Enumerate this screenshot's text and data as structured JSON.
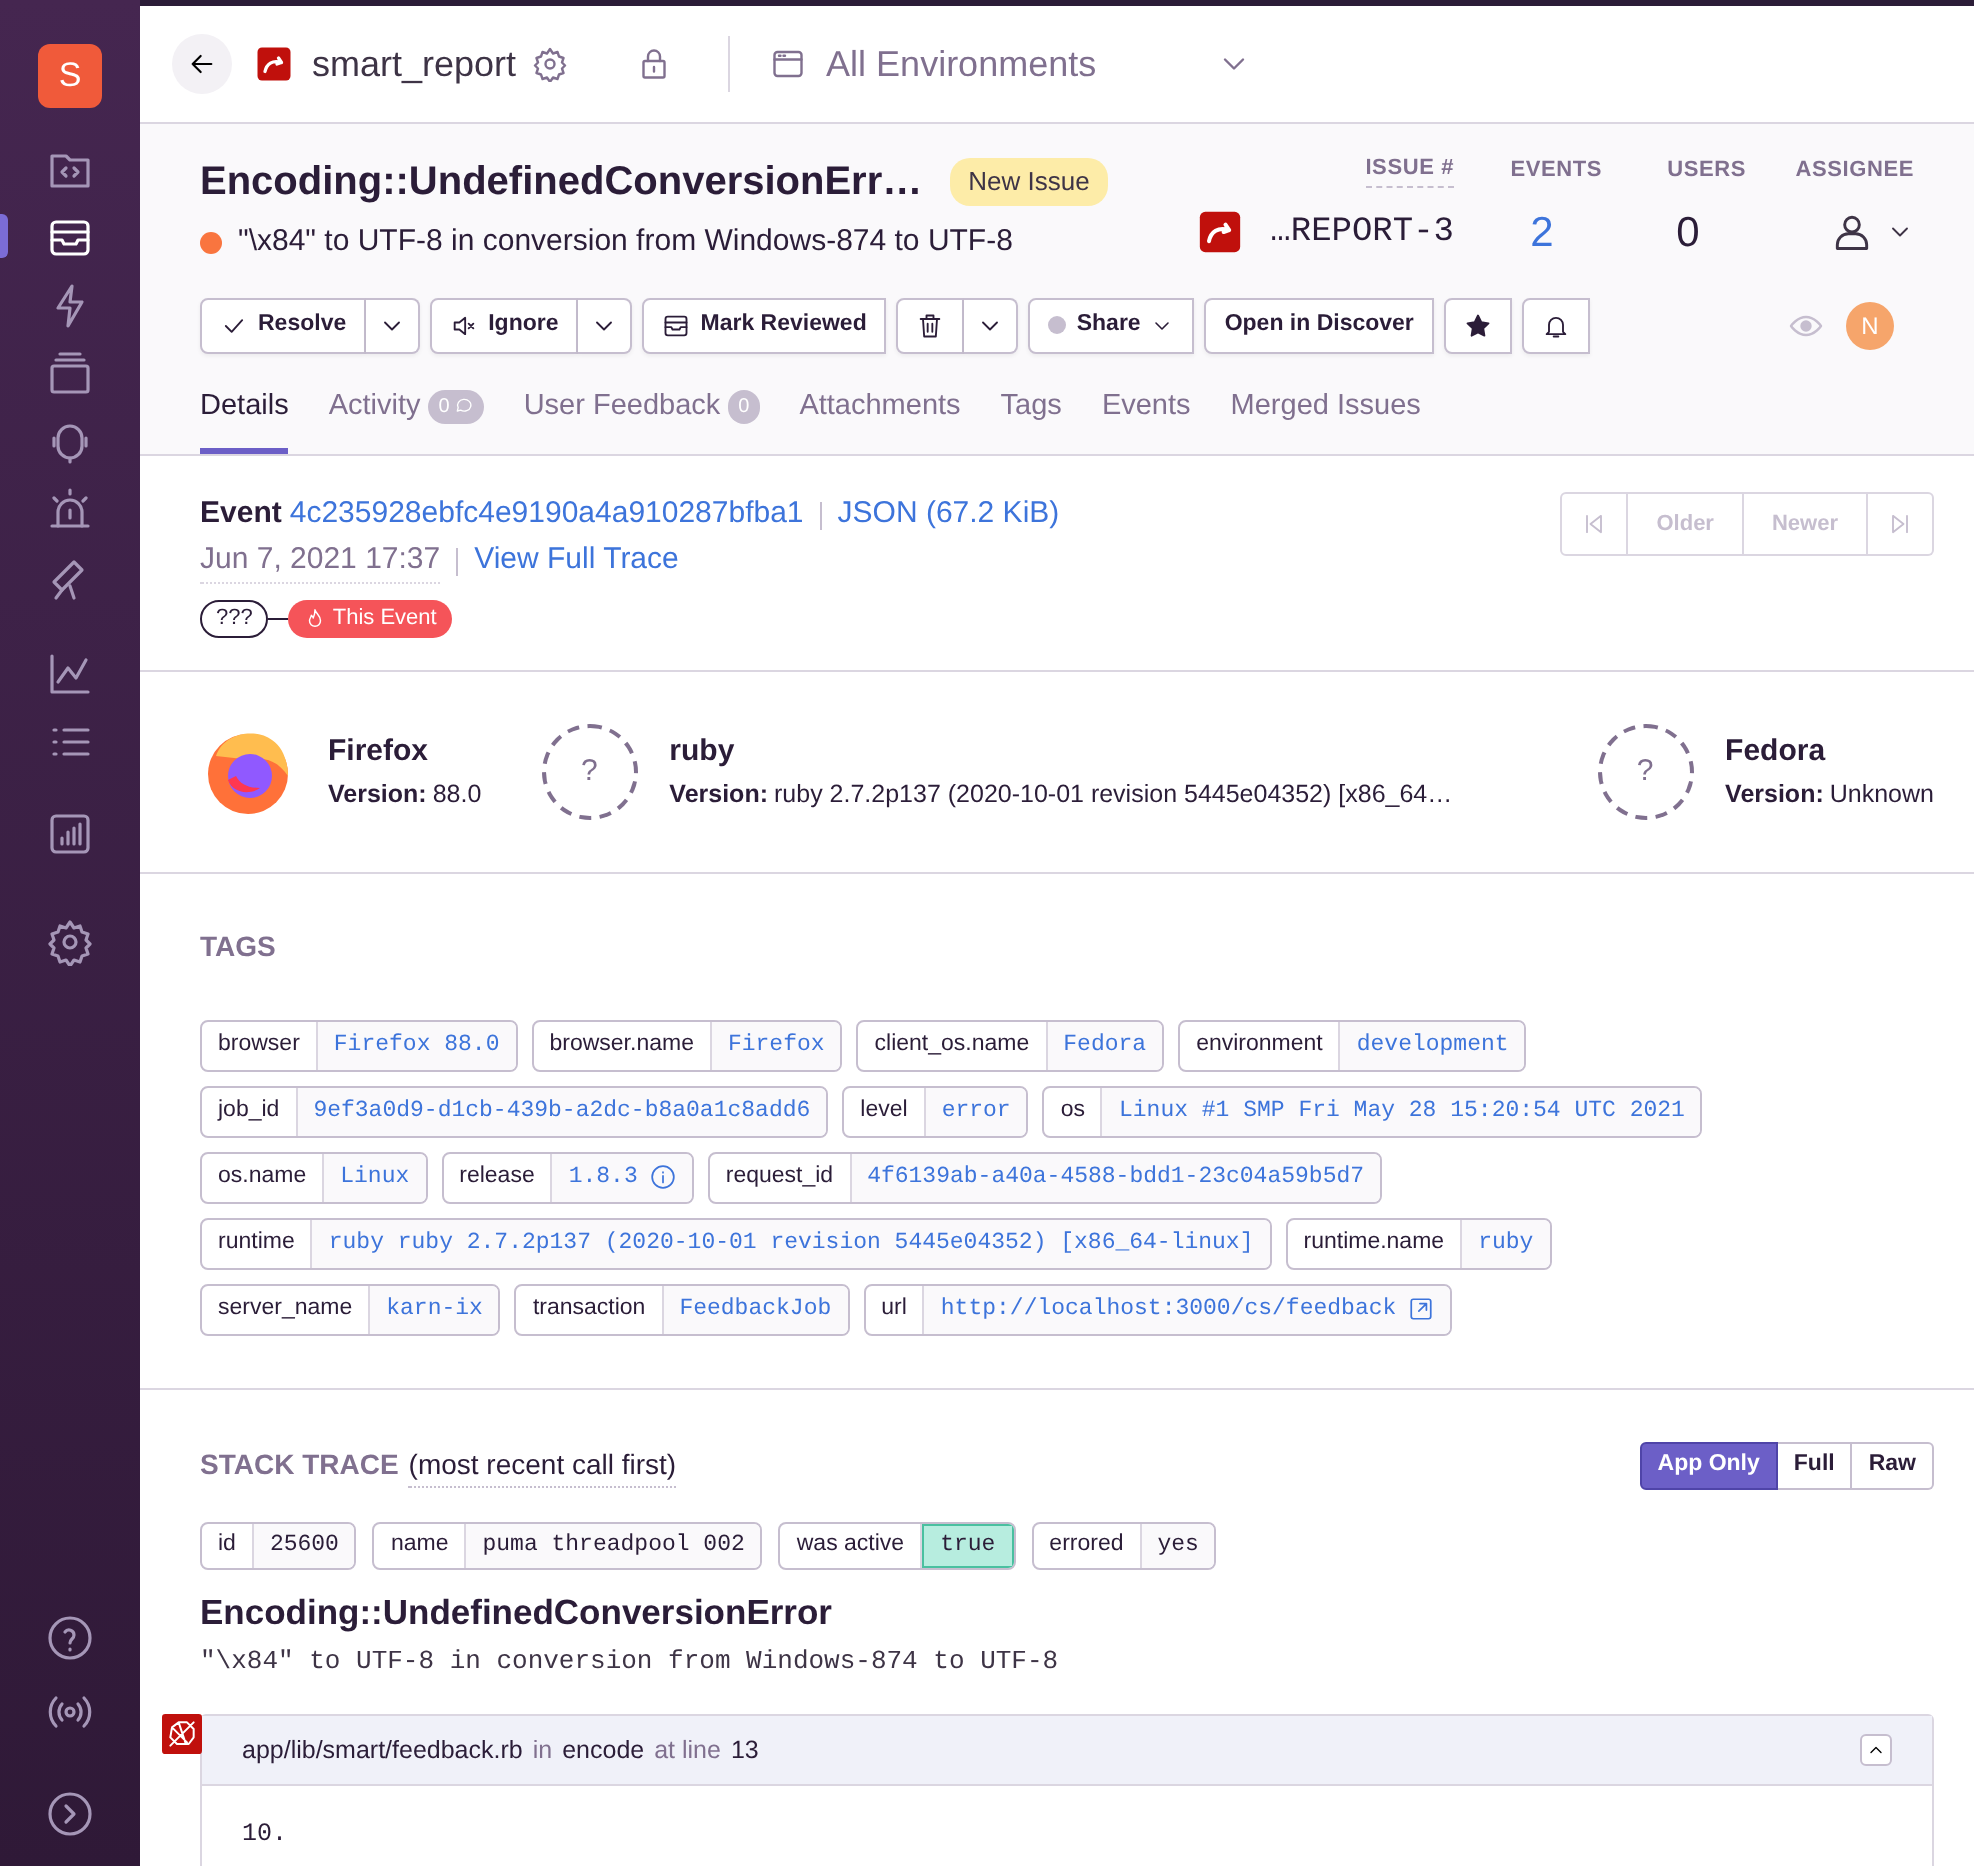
{
  "sidebar": {
    "org_initial": "S",
    "items": [
      {
        "selected": false
      },
      {
        "selected": true
      },
      {
        "selected": false
      },
      {
        "selected": false
      },
      {
        "selected": false
      },
      {
        "selected": false
      },
      {
        "selected": false
      },
      {
        "selected": false
      },
      {
        "selected": false
      },
      {
        "selected": false
      },
      {
        "selected": false
      }
    ],
    "bottom_items": [
      {
        "selected": false
      },
      {
        "selected": false
      },
      {
        "selected": false
      }
    ]
  },
  "breadcrumb": {
    "project": "smart_report",
    "environment": "All Environments"
  },
  "issue": {
    "title": "Encoding::UndefinedConversionErr…",
    "badge": "New Issue",
    "message": "\"\\x84\" to UTF-8 in conversion from Windows-874 to UTF-8",
    "short_id": "…REPORT-3",
    "stats": [
      {
        "label": "ISSUE #"
      },
      {
        "label": "EVENTS",
        "value": "2"
      },
      {
        "label": "USERS",
        "value": "0"
      },
      {
        "label": "ASSIGNEE"
      }
    ],
    "avatar": "N"
  },
  "actions": [
    {
      "label": "Resolve",
      "dropdown": true
    },
    {
      "label": "Ignore",
      "dropdown": true
    },
    {
      "label": "Mark Reviewed",
      "dropdown": false
    },
    {
      "dropdown": true
    },
    {
      "label": "Share",
      "dropdown": false
    },
    {
      "label": "Open in Discover",
      "dropdown": false
    },
    {
      "dropdown": false
    },
    {
      "dropdown": false
    }
  ],
  "tabs": [
    {
      "label": "Details",
      "selected": true
    },
    {
      "label": "Activity",
      "selected": false,
      "badge": "0"
    },
    {
      "label": "User Feedback",
      "selected": false,
      "badge": "0"
    },
    {
      "label": "Attachments",
      "selected": false
    },
    {
      "label": "Tags",
      "selected": false
    },
    {
      "label": "Events",
      "selected": false
    },
    {
      "label": "Merged Issues",
      "selected": false
    }
  ],
  "event": {
    "label": "Event",
    "id": "4c235928ebfc4e9190a4a910287bfba1",
    "json": "JSON (67.2 KiB)",
    "date": "Jun 7, 2021 17:37",
    "trace_link": "View Full Trace",
    "nav": [
      {
        "disabled": true
      },
      {
        "label": "Older",
        "disabled": true
      },
      {
        "label": "Newer",
        "disabled": true
      },
      {
        "disabled": true
      }
    ],
    "release": "???",
    "this_event": "This Event"
  },
  "contexts": [
    {
      "kind": "firefox",
      "name": "Firefox",
      "version_label": "Version:",
      "version": "88.0"
    },
    {
      "kind": "unknown",
      "icon_text": "?",
      "name": "ruby",
      "version_label": "Version:",
      "version": "ruby 2.7.2p137 (2020-10-01 revision 5445e04352) [x86_64…"
    },
    {
      "kind": "unknown",
      "icon_text": "?",
      "name": "Fedora",
      "version_label": "Version:",
      "version": "Unknown"
    }
  ],
  "tags": {
    "title": "TAGS",
    "items": [
      {
        "key": "browser",
        "value": "Firefox 88.0",
        "kind": "plain"
      },
      {
        "key": "browser.name",
        "value": "Firefox",
        "kind": "plain"
      },
      {
        "key": "client_os.name",
        "value": "Fedora",
        "kind": "plain"
      },
      {
        "key": "environment",
        "value": "development",
        "kind": "plain"
      },
      {
        "key": "job_id",
        "value": "9ef3a0d9-d1cb-439b-a2dc-b8a0a1c8add6",
        "kind": "plain"
      },
      {
        "key": "level",
        "value": "error",
        "kind": "plain"
      },
      {
        "key": "os",
        "value": "Linux #1 SMP Fri May 28 15:20:54 UTC 2021",
        "kind": "plain"
      },
      {
        "key": "os.name",
        "value": "Linux",
        "kind": "plain"
      },
      {
        "key": "release",
        "value": "1.8.3",
        "kind": "info"
      },
      {
        "key": "request_id",
        "value": "4f6139ab-a40a-4588-bdd1-23c04a59b5d7",
        "kind": "plain"
      },
      {
        "key": "runtime",
        "value": "ruby ruby 2.7.2p137 (2020-10-01 revision 5445e04352) [x86_64-linux]",
        "kind": "plain"
      },
      {
        "key": "runtime.name",
        "value": "ruby",
        "kind": "plain"
      },
      {
        "key": "server_name",
        "value": "karn-ix",
        "kind": "plain"
      },
      {
        "key": "transaction",
        "value": "FeedbackJob",
        "kind": "plain"
      },
      {
        "key": "url",
        "value": "http://localhost:3000/cs/feedback",
        "kind": "link"
      }
    ]
  },
  "stack": {
    "title": "STACK TRACE",
    "subtitle": "(most recent call first)",
    "toggle": [
      {
        "label": "App Only",
        "selected": true
      },
      {
        "label": "Full",
        "selected": false
      },
      {
        "label": "Raw",
        "selected": false
      }
    ],
    "thread": [
      {
        "key": "id",
        "value": "25600",
        "highlight": false
      },
      {
        "key": "name",
        "value": "puma threadpool 002",
        "highlight": false
      },
      {
        "key": "was active",
        "value": "true",
        "highlight": true
      },
      {
        "key": "errored",
        "value": "yes",
        "highlight": false
      }
    ],
    "exception_type": "Encoding::UndefinedConversionError",
    "exception_value": "\"\\x84\" to UTF-8 in conversion from Windows-874 to UTF-8",
    "frame": {
      "path": "app/lib/smart/feedback.rb",
      "in": "in",
      "function": "encode",
      "at": "at line",
      "line": "13",
      "expanded": true,
      "lines": [
        {
          "number": "10."
        }
      ]
    }
  }
}
